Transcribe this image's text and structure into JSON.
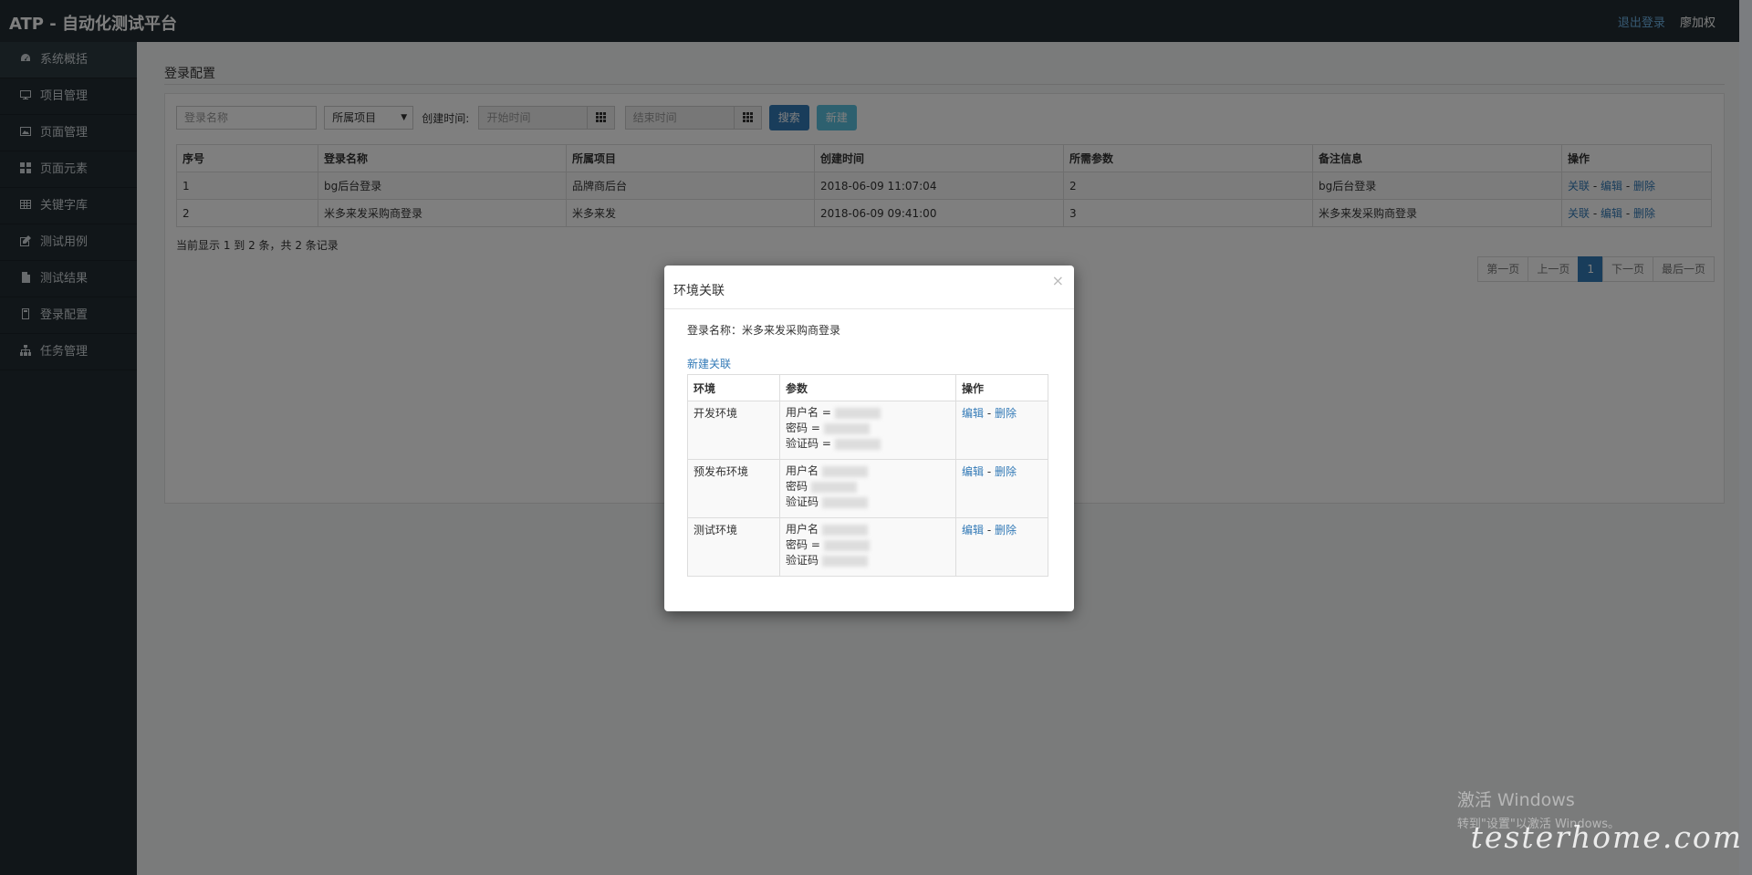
{
  "app": {
    "title": "ATP - 自动化测试平台"
  },
  "header": {
    "logout": "退出登录",
    "user": "廖加权"
  },
  "sidebar": {
    "items": [
      {
        "label": "系统概括",
        "icon": "dashboard-icon"
      },
      {
        "label": "项目管理",
        "icon": "monitor-icon"
      },
      {
        "label": "页面管理",
        "icon": "image-icon"
      },
      {
        "label": "页面元素",
        "icon": "th-icon"
      },
      {
        "label": "关键字库",
        "icon": "table-icon"
      },
      {
        "label": "测试用例",
        "icon": "edit-icon"
      },
      {
        "label": "测试结果",
        "icon": "file-icon"
      },
      {
        "label": "登录配置",
        "icon": "book-icon"
      },
      {
        "label": "任务管理",
        "icon": "sitemap-icon"
      }
    ]
  },
  "page": {
    "title": "登录配置"
  },
  "filters": {
    "name_placeholder": "登录名称",
    "project_select": "所属项目",
    "created_label": "创建时间:",
    "start_placeholder": "开始时间",
    "end_placeholder": "结束时间",
    "search_button": "搜索",
    "new_button": "新建"
  },
  "table": {
    "headers": [
      "序号",
      "登录名称",
      "所属项目",
      "创建时间",
      "所需参数",
      "备注信息",
      "操作"
    ],
    "rows": [
      {
        "index": "1",
        "name": "bg后台登录",
        "project": "品牌商后台",
        "created": "2018-06-09 11:07:04",
        "params": "2",
        "note": "bg后台登录"
      },
      {
        "index": "2",
        "name": "米多来发采购商登录",
        "project": "米多来发",
        "created": "2018-06-09 09:41:00",
        "params": "3",
        "note": "米多来发采购商登录"
      }
    ],
    "actions": {
      "link": "关联",
      "edit": "编辑",
      "delete": "删除",
      "sep": " - "
    }
  },
  "summary": "当前显示 1 到 2 条，共 2 条记录",
  "pager": {
    "first": "第一页",
    "prev": "上一页",
    "current": "1",
    "next": "下一页",
    "last": "最后一页"
  },
  "modal": {
    "title": "环境关联",
    "close": "×",
    "login_label": "登录名称：",
    "login_value": "米多来发采购商登录",
    "new_link": "新建关联",
    "headers": [
      "环境",
      "参数",
      "操作"
    ],
    "envs": [
      {
        "name": "开发环境",
        "p1": "用户名 =",
        "p2": "密码 =",
        "p3": "验证码 ="
      },
      {
        "name": "预发布环境",
        "p1": "用户名",
        "p2": "密码",
        "p3": "验证码"
      },
      {
        "name": "测试环境",
        "p1": "用户名",
        "p2": "密码 =",
        "p3": "验证码"
      }
    ],
    "edit": "编辑",
    "sep": " - ",
    "delete": "删除"
  },
  "watermark": {
    "line1": "激活 Windows",
    "line2": "转到\"设置\"以激活 Windows。",
    "site": "testerhome.com"
  }
}
